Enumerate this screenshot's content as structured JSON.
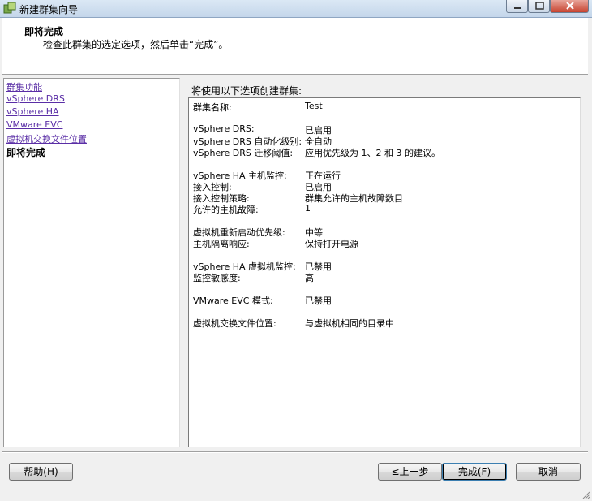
{
  "window": {
    "title": "新建群集向导"
  },
  "header": {
    "title": "即将完成",
    "subtitle": "检查此群集的选定选项，然后单击“完成”。"
  },
  "nav": {
    "items": [
      "群集功能",
      "vSphere DRS",
      "vSphere HA",
      "VMware EVC",
      "虚拟机交换文件位置"
    ],
    "current": "即将完成"
  },
  "summary": {
    "heading": "将使用以下选项创建群集:",
    "rows": [
      {
        "label": "群集名称:",
        "value": "Test"
      },
      {
        "label": "vSphere DRS:",
        "value": "已启用"
      },
      {
        "label": "vSphere DRS 自动化级别:",
        "value": "全自动"
      },
      {
        "label": "vSphere DRS 迁移阈值:",
        "value": "应用优先级为 1、2 和 3 的建议。"
      },
      {
        "label": "vSphere HA 主机监控:",
        "value": "正在运行"
      },
      {
        "label": "接入控制:",
        "value": "已启用"
      },
      {
        "label": "接入控制策略:",
        "value": "群集允许的主机故障数目"
      },
      {
        "label": "允许的主机故障:",
        "value": "1"
      },
      {
        "label": "虚拟机重新启动优先级:",
        "value": "中等"
      },
      {
        "label": "主机隔离响应:",
        "value": "保持打开电源"
      },
      {
        "label": "vSphere HA 虚拟机监控:",
        "value": "已禁用"
      },
      {
        "label": "监控敏感度:",
        "value": "高"
      },
      {
        "label": "VMware EVC 模式:",
        "value": "已禁用"
      },
      {
        "label": "虚拟机交换文件位置:",
        "value": "与虚拟机相同的目录中"
      }
    ]
  },
  "buttons": {
    "help": "帮助(H)",
    "back": "≤上一步",
    "finish": "完成(F)",
    "cancel": "取消"
  }
}
